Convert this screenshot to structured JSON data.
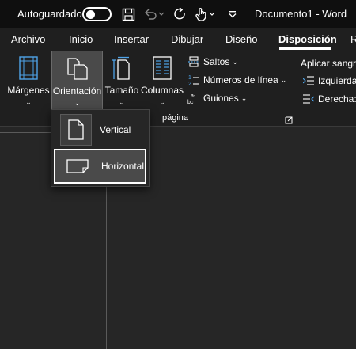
{
  "titlebar": {
    "autosave_label": "Autoguardado",
    "autosave_state": "off",
    "document_title": "Documento1  -  Word"
  },
  "quick_access": [
    "save-icon",
    "undo-icon",
    "redo-icon",
    "touch-mode-icon",
    "customize-icon"
  ],
  "tabs": [
    {
      "label": "Archivo"
    },
    {
      "label": "Inicio"
    },
    {
      "label": "Insertar"
    },
    {
      "label": "Dibujar"
    },
    {
      "label": "Diseño"
    },
    {
      "label": "Disposición",
      "active": true
    },
    {
      "label": "R"
    }
  ],
  "ribbon": {
    "buttons": [
      {
        "label": "Márgenes",
        "chevron": "⌄"
      },
      {
        "label": "Orientación",
        "chevron": "⌄",
        "pressed": true
      },
      {
        "label": "Tamaño",
        "chevron": "⌄"
      },
      {
        "label": "Columnas",
        "chevron": "⌄"
      }
    ],
    "small_buttons": [
      {
        "label": "Saltos",
        "chevron": "⌄"
      },
      {
        "label": "Números de línea",
        "chevron": "⌄"
      },
      {
        "label": "Guiones",
        "chevron": "⌄"
      }
    ],
    "group_label": "página",
    "indent": {
      "title": "Aplicar sangrí",
      "left_label": "Izquierda:",
      "right_label": "Derecha:"
    }
  },
  "orientation_menu": {
    "items": [
      {
        "label": "Vertical"
      },
      {
        "label": "Horizontal",
        "hovered": true
      }
    ]
  },
  "colors": {
    "titlebar_bg": "#0f0f0f",
    "ribbon_bg": "#1f1f1f",
    "canvas_bg": "#262626",
    "hover_bg": "#4a4a4a",
    "text": "#ffffff"
  }
}
